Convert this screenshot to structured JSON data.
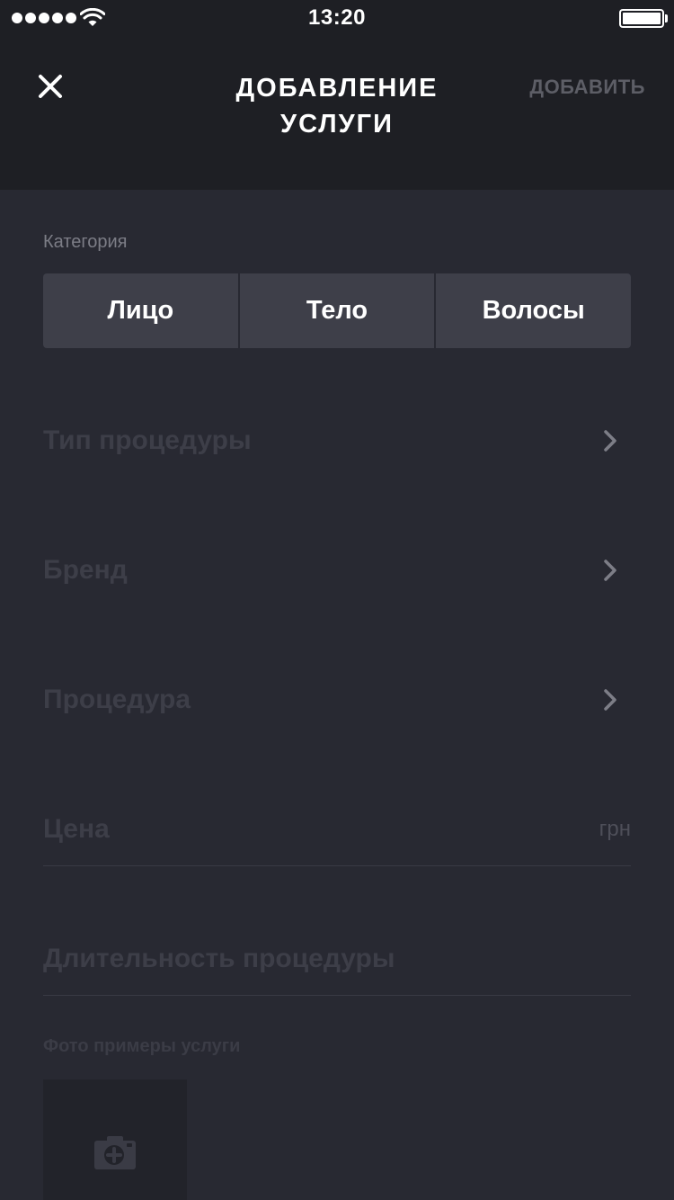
{
  "status_bar": {
    "time": "13:20",
    "signal_dots": 5,
    "signal_icon": "signal-dots-icon",
    "wifi_icon": "wifi-icon",
    "battery_icon": "battery-icon",
    "battery_level": 1.0
  },
  "header": {
    "close_icon": "close-icon",
    "title": "ДОБАВЛЕНИЕ УСЛУГИ",
    "add_label": "ДОБАВИТЬ"
  },
  "category": {
    "label": "Категория",
    "options": [
      "Лицо",
      "Тело",
      "Волосы"
    ]
  },
  "fields": {
    "procedure_type": "Тип процедуры",
    "brand": "Бренд",
    "procedure": "Процедура",
    "price_placeholder": "Цена",
    "price_unit": "грн",
    "duration_placeholder": "Длительность процедуры"
  },
  "photos": {
    "label": "Фото примеры услуги",
    "add_icon": "camera-add-icon"
  },
  "colors": {
    "background": "#282932",
    "header": "#1e1f24",
    "segment": "#3e3f49",
    "muted_text": "#3d3e48"
  }
}
